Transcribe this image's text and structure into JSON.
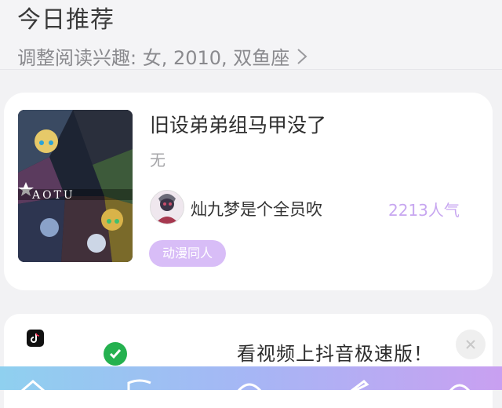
{
  "header": {
    "title": "今日推荐",
    "prefs_label": "调整阅读兴趣: 女, 2010, 双鱼座"
  },
  "book": {
    "title": "旧设弟弟组马甲没了",
    "description": "无",
    "author": "灿九梦是个全员吹",
    "popularity": "2213人气",
    "tag": "动漫同人",
    "cover_text": "AOTU"
  },
  "ad": {
    "text": "看视频上抖音极速版！"
  },
  "tabbar": {
    "icons": [
      "home-icon",
      "book-icon",
      "discover-icon",
      "write-icon",
      "profile-icon"
    ]
  },
  "colors": {
    "accent_purple": "#c7a6f0",
    "tag_bg": "#d8bdf7",
    "ad_check": "#24b14f"
  }
}
